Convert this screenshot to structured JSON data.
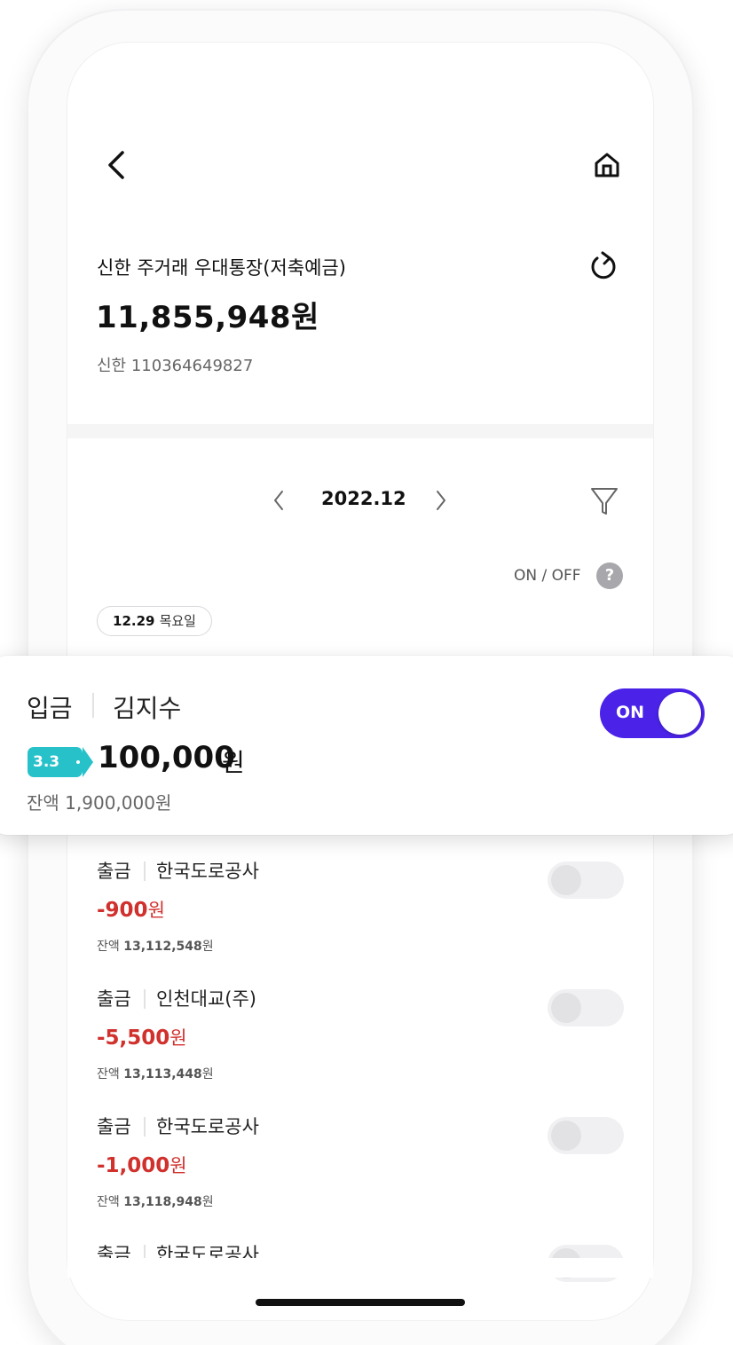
{
  "account": {
    "name": "신한 주거래 우대통장(저축예금)",
    "balance": "11,855,948원",
    "number": "신한 110364649827"
  },
  "period": {
    "month": "2022.12",
    "toggle_hint": "ON / OFF",
    "help": "?"
  },
  "date_chip": {
    "date": "12.29",
    "weekday": "목요일"
  },
  "highlighted": {
    "type": "입금",
    "party": "김지수",
    "badge": "3.3",
    "amount": "100,000",
    "unit": "원",
    "balance": "잔액 1,900,000원",
    "toggle": {
      "label": "ON",
      "on": true
    },
    "accent": "#4a22e8",
    "badge_color": "#27c1c9"
  },
  "transactions": [
    {
      "type": "출금",
      "party": "한국도로공사",
      "amount": "-900",
      "unit": "원",
      "balance_label": "잔액",
      "balance": "13,112,548",
      "balance_unit": "원",
      "toggle_on": false
    },
    {
      "type": "출금",
      "party": "인천대교(주)",
      "amount": "-5,500",
      "unit": "원",
      "balance_label": "잔액",
      "balance": "13,113,448",
      "balance_unit": "원",
      "toggle_on": false
    },
    {
      "type": "출금",
      "party": "한국도로공사",
      "amount": "-1,000",
      "unit": "원",
      "balance_label": "잔액",
      "balance": "13,118,948",
      "balance_unit": "원",
      "toggle_on": false
    },
    {
      "type": "출금",
      "party": "한국도로공사",
      "toggle_on": false
    }
  ],
  "icons": {
    "back": "chevron-left-icon",
    "home": "home-icon",
    "refresh": "refresh-icon",
    "filter": "filter-icon"
  },
  "colors": {
    "withdraw_amount": "#d0312d",
    "toggle_on": "#4a22e8"
  }
}
